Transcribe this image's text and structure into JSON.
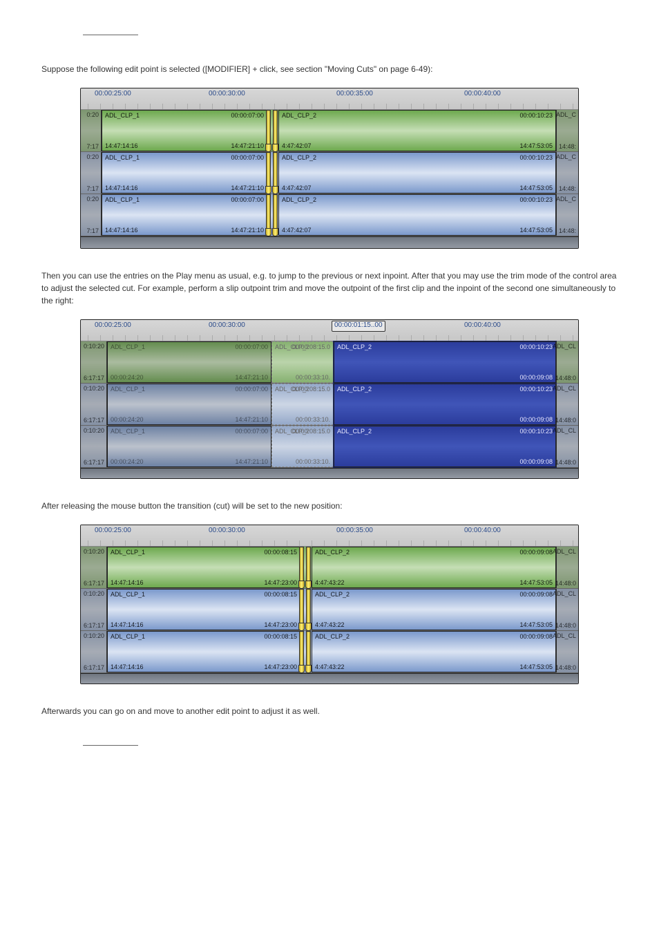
{
  "para1_pre": "Suppose the following edit point is selected (",
  "para1_em": "[MODIFIER]",
  "para1_post": " + click, see section \"Moving Cuts\" on page 6-49):",
  "para2": "Then you can use the entries on the Play menu as usual, e.g. to jump to the previous or next inpoint. After that you may use the trim mode of the control area to adjust the selected cut. For example, perform a slip outpoint trim and move the outpoint of the first clip and the inpoint of the second one simultaneously to the right:",
  "para3": "After releasing the mouse button the transition (cut) will be set to the new position:",
  "para4": "Afterwards you can go on and move to another edit point to adjust it as well.",
  "tick_labels": [
    "00:00:25:00",
    "00:00:30:00",
    "00:00:35:00",
    "00:00:40:00"
  ],
  "tick_labels_b": [
    "00:00:25:00",
    "00:00:30:00",
    "",
    "00:00:40:00"
  ],
  "inputbox": "00:00:01:15..00",
  "edge_a_top": "0:20",
  "edge_a_bot": "7:17",
  "edge_b_top": "0:10:20",
  "edge_b_bot": "6:17:17",
  "clip1_name": "ADL_CLP_1",
  "clip2_name": "ADL_CLP_2",
  "clip2_ghost": "ADL_CLP_2",
  "clip2_sel": "ADL_CLP_2",
  "A": {
    "c1_tr": "00:00:07:00",
    "c1_bl": "14:47:14:16",
    "c1_br": "14:47:21:10",
    "c2_tl": "4:47:42:07",
    "c2_tr": "00:00:10:23",
    "c2_br": "14:47:53:05",
    "r_top": "ADL_C",
    "r_bot": "14:48:"
  },
  "B": {
    "c1_tr": "00:00:07:00",
    "c1_bl": "00:00:24:20",
    "c1_br": "14:47:21:10",
    "mid_top": "00:00:08:15.0",
    "mid_bot": "00:00:33:10.",
    "c2_tr": "00:00:10:23",
    "c2_br": "00:00:09:08",
    "sel_br2": "14:48:0",
    "r_top": "ADL_CL"
  },
  "C": {
    "c1_tr": "00:00:08:15",
    "c1_bl": "14:47:14:16",
    "c1_br": "14:47:23:00",
    "c2_tl": "4:47:43:22",
    "c2_tr": "00:00:09:08",
    "c2_br": "14:47:53:05",
    "r_top": "ADL_CL",
    "r_bot": "14:48:0"
  }
}
